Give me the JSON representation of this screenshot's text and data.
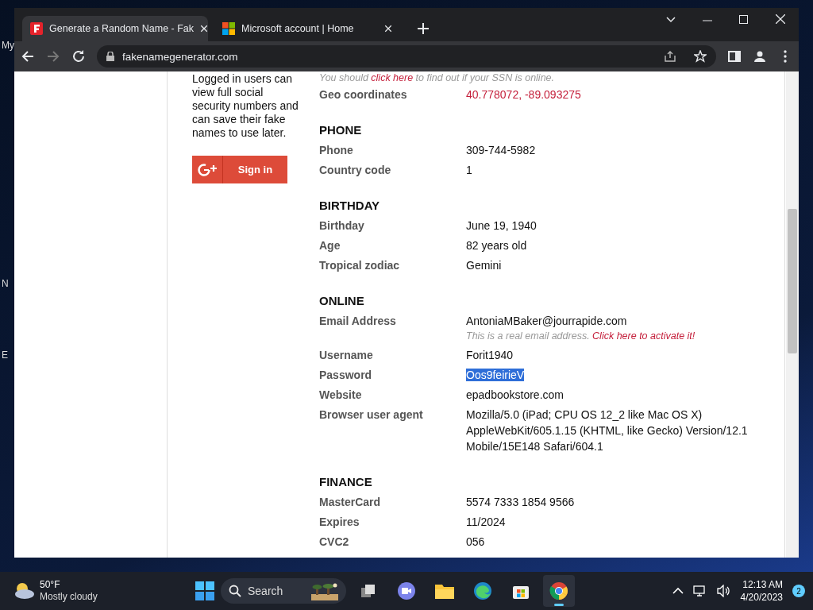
{
  "desktop": {
    "icon_labels": [
      "My",
      "N",
      "E"
    ]
  },
  "browser": {
    "tabs": [
      {
        "title": "Generate a Random Name - Fak",
        "kind": "f",
        "selected": true
      },
      {
        "title": "Microsoft account | Home",
        "kind": "ms",
        "selected": false
      }
    ],
    "address": "fakenamegenerator.com"
  },
  "page": {
    "sidebar": {
      "text": "Logged in users can view full social security numbers and can save their fake names to use later.",
      "button": "Sign in"
    },
    "top_note": {
      "before": "You should ",
      "link": "click here",
      "after": " to find out if your SSN is online."
    },
    "sections": [
      {
        "rows": [
          {
            "label": "Geo coordinates",
            "value": "40.778072, -89.093275",
            "kind": "link",
            "selected": false
          }
        ]
      },
      {
        "title": "PHONE",
        "rows": [
          {
            "label": "Phone",
            "value": "309-744-5982",
            "kind": "plain",
            "selected": false
          },
          {
            "label": "Country code",
            "value": "1",
            "kind": "plain",
            "selected": false
          }
        ]
      },
      {
        "title": "BIRTHDAY",
        "rows": [
          {
            "label": "Birthday",
            "value": "June 19, 1940",
            "kind": "plain",
            "selected": false
          },
          {
            "label": "Age",
            "value": "82 years old",
            "kind": "plain",
            "selected": false
          },
          {
            "label": "Tropical zodiac",
            "value": "Gemini",
            "kind": "plain",
            "selected": false
          }
        ]
      },
      {
        "title": "ONLINE",
        "rows": [
          {
            "label": "Email Address",
            "value": "AntoniaMBaker@jourrapide.com",
            "kind": "plain",
            "selected": false,
            "note": {
              "before": "This is a real email address. ",
              "link": "Click here to activate it!"
            }
          },
          {
            "label": "Username",
            "value": "Forit1940",
            "kind": "plain",
            "selected": false
          },
          {
            "label": "Password",
            "value": "Oos9feirieV",
            "kind": "plain",
            "selected": true
          },
          {
            "label": "Website",
            "value": "epadbookstore.com",
            "kind": "plain",
            "selected": false
          },
          {
            "label": "Browser user agent",
            "value": "Mozilla/5.0 (iPad; CPU OS 12_2 like Mac OS X) AppleWebKit/605.1.15 (KHTML, like Gecko) Version/12.1 Mobile/15E148 Safari/604.1",
            "kind": "plain",
            "selected": false
          }
        ]
      },
      {
        "title": "FINANCE",
        "rows": [
          {
            "label": "MasterCard",
            "value": "5574 7333 1854 9566",
            "kind": "plain",
            "selected": false
          },
          {
            "label": "Expires",
            "value": "11/2024",
            "kind": "plain",
            "selected": false
          },
          {
            "label": "CVC2",
            "value": "056",
            "kind": "plain",
            "selected": false
          }
        ]
      }
    ]
  },
  "taskbar": {
    "weather": {
      "temp": "50°F",
      "condition": "Mostly cloudy"
    },
    "search": "Search",
    "apps": [
      {
        "kind": "task-view",
        "selected": false
      },
      {
        "kind": "chat",
        "selected": false
      },
      {
        "kind": "folder",
        "selected": false
      },
      {
        "kind": "edge",
        "selected": false
      },
      {
        "kind": "store",
        "selected": false
      },
      {
        "kind": "chrome",
        "selected": true
      }
    ],
    "time": "12:13 AM",
    "date": "4/20/2023",
    "notifications": "2"
  }
}
